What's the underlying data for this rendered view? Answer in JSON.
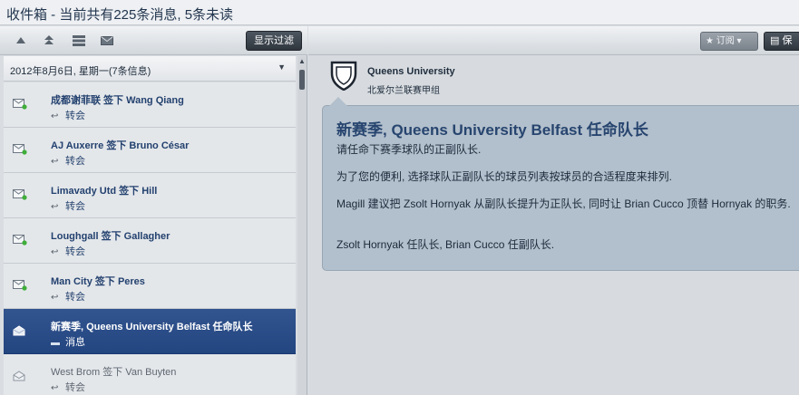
{
  "window": {
    "title": "收件箱 - 当前共有225条消息, 5条未读"
  },
  "left_toolbar": {
    "icons": [
      "up-arrow-icon",
      "double-up-arrow-icon",
      "list-icon",
      "envelope-icon"
    ],
    "filter_label": "显示过滤"
  },
  "date_group": {
    "label": "2012年8月6日, 星期一(7条信息)"
  },
  "messages": [
    {
      "title": "成都谢菲联 签下 Wang Qiang",
      "subtitle": "转会",
      "state": "unread"
    },
    {
      "title": "AJ Auxerre 签下 Bruno César",
      "subtitle": "转会",
      "state": "unread"
    },
    {
      "title": "Limavady Utd 签下 Hill",
      "subtitle": "转会",
      "state": "unread"
    },
    {
      "title": "Loughgall 签下 Gallagher",
      "subtitle": "转会",
      "state": "unread"
    },
    {
      "title": "Man City 签下 Peres",
      "subtitle": "转会",
      "state": "unread"
    },
    {
      "title": "新赛季, Queens University Belfast 任命队长",
      "subtitle": "消息",
      "state": "selected"
    },
    {
      "title": "West Brom 签下 Van Buyten",
      "subtitle": "转会",
      "state": "read"
    }
  ],
  "right_toolbar": {
    "subscribe_label": "订阅",
    "action_label": "保"
  },
  "detail": {
    "sender_name": "Queens University",
    "sender_league": "北爱尔兰联赛甲组",
    "title": "新赛季, Queens University Belfast 任命队长",
    "paragraphs": [
      "请任命下赛季球队的正副队长.",
      "为了您的便利, 选择球队正副队长的球员列表按球员的合适程度来排列.",
      "Magill 建议把 Zsolt Hornyak 从副队长提升为正队长, 同时让 Brian Cucco 顶替 Hornyak 的职务.",
      "Zsolt Hornyak 任队长, Brian Cucco 任副队长."
    ]
  },
  "colors": {
    "selected_row": "#2a4a86",
    "title_blue": "#27456f",
    "bubble": "#b2bfcc"
  }
}
